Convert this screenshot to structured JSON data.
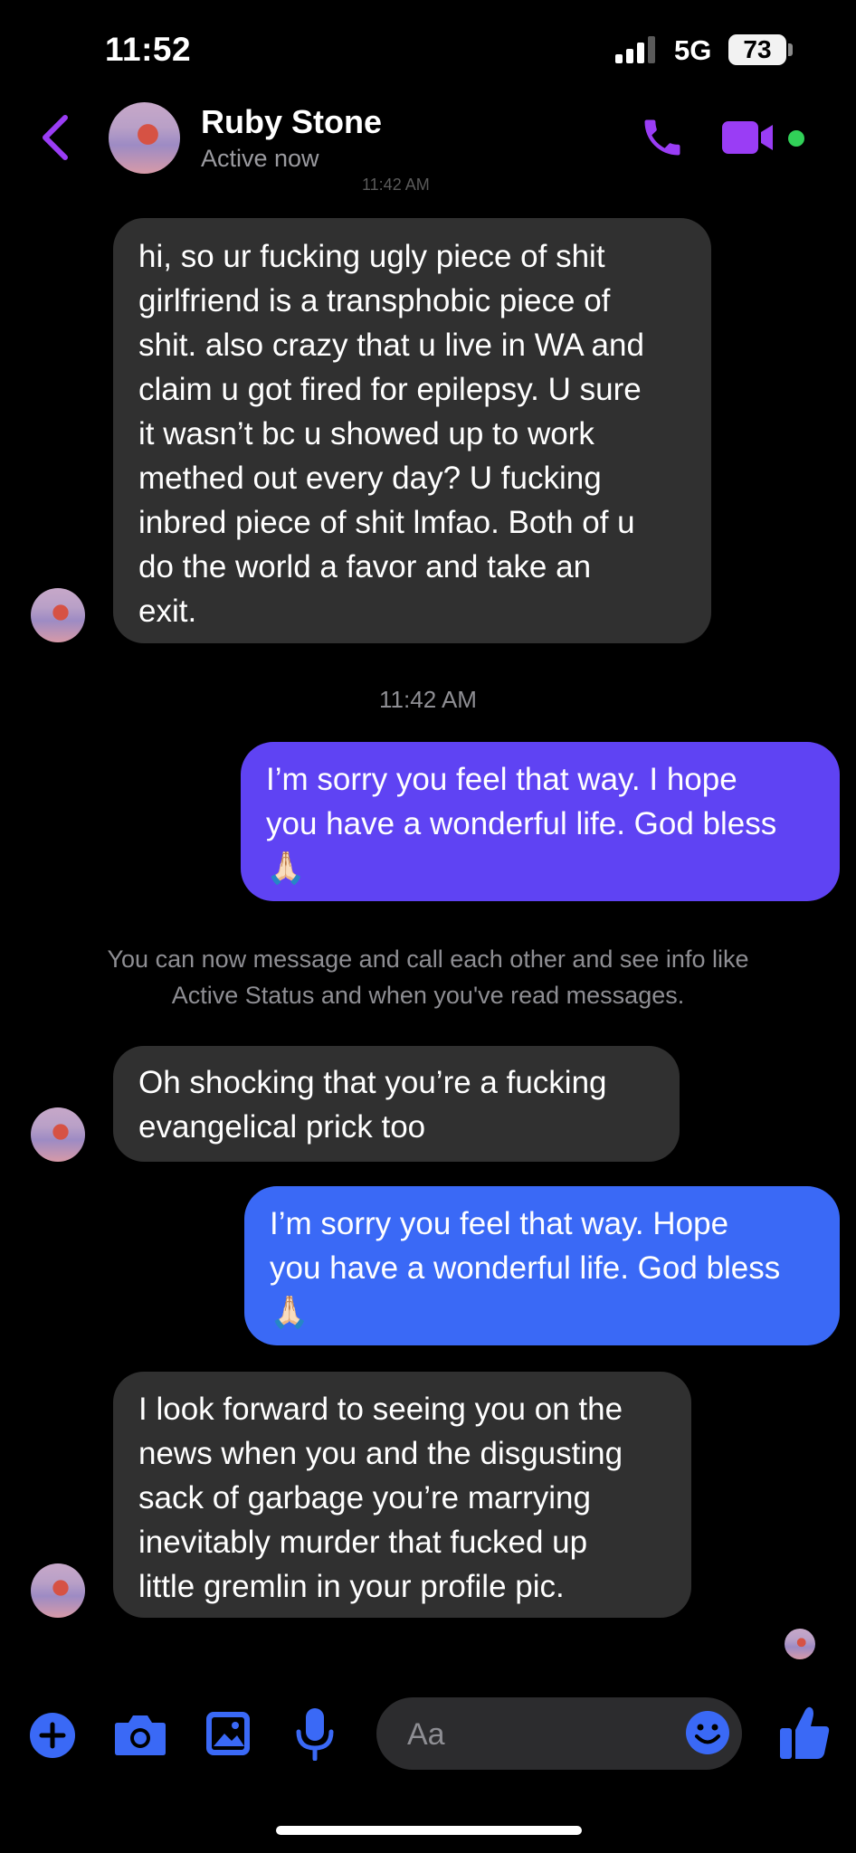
{
  "status_bar": {
    "time": "11:52",
    "network": "5G",
    "battery": "73"
  },
  "header": {
    "name": "Ruby Stone",
    "status": "Active now",
    "cut_timestamp": "11:42 AM"
  },
  "messages": [
    {
      "side": "incoming",
      "lines": [
        "hi, so ur fucking ugly piece of shit",
        "girlfriend is a transphobic piece of",
        "shit. also crazy that u live in WA and",
        "claim u got fired for epilepsy. U sure",
        "it wasn’t bc u showed up to work",
        "methed out every day? U fucking",
        "inbred piece of shit lmfao. Both of u",
        "do the world a favor and take an",
        "exit."
      ]
    },
    {
      "side": "outgoing",
      "lines": [
        "I’m sorry you feel that way. I hope",
        "you have a wonderful life. God bless",
        "🙏🏻"
      ]
    },
    {
      "side": "incoming",
      "lines": [
        "Oh shocking that you’re a fucking",
        "evangelical prick too"
      ]
    },
    {
      "side": "outgoing",
      "lines": [
        "I’m sorry you feel that way. Hope",
        "you have a wonderful life. God bless",
        "🙏🏻"
      ]
    },
    {
      "side": "incoming",
      "lines": [
        "I look forward to seeing you on the",
        "news when you and the disgusting",
        "sack of garbage you’re marrying",
        "inevitably murder that fucked up",
        "little gremlin in your profile pic."
      ]
    }
  ],
  "timestamp": "11:42 AM",
  "notice": {
    "line1": "You can now message and call each other and see info like",
    "line2": "Active Status and when you've read messages."
  },
  "composer": {
    "placeholder": "Aa"
  },
  "colors": {
    "accent": "#9a3df5",
    "blue": "#3a69f6",
    "purple_bubble": "#5f43f3",
    "incoming_bubble": "#303030"
  }
}
